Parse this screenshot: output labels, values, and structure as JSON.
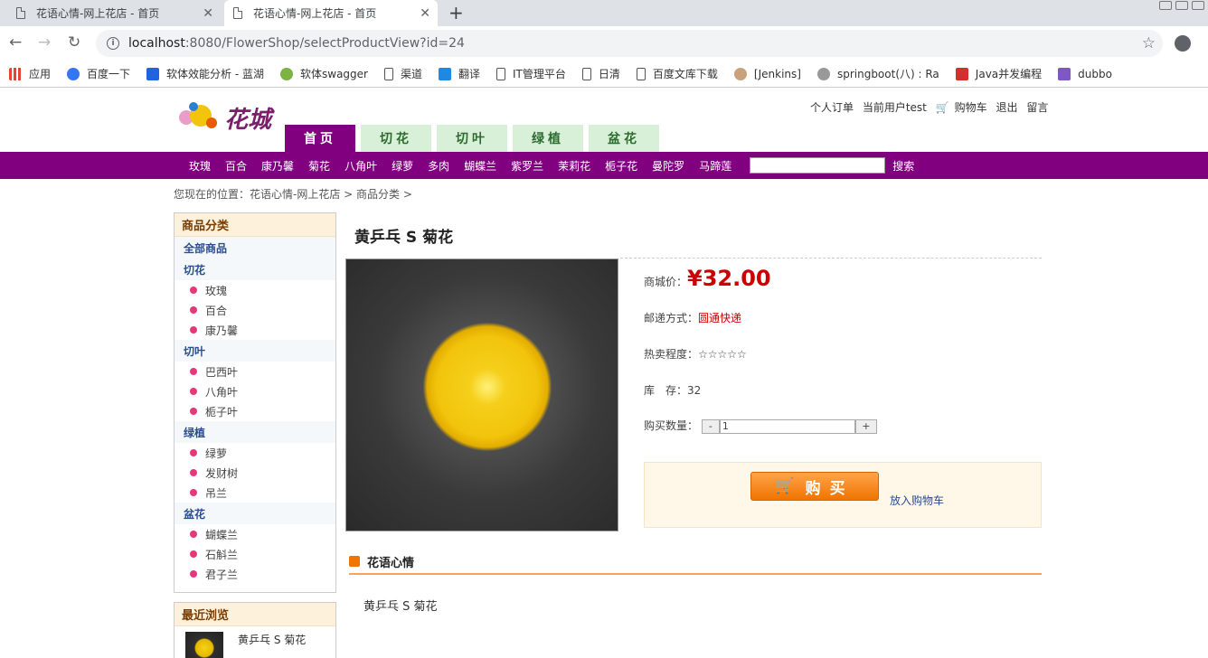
{
  "browser": {
    "tabs": [
      {
        "title": "花语心情-网上花店 - 首页"
      },
      {
        "title": "花语心情-网上花店 - 首页"
      }
    ],
    "url_host": "localhost",
    "url_rest": ":8080/FlowerShop/selectProductView?id=24",
    "bookmarks": [
      "应用",
      "百度一下",
      "软体效能分析 - 蓝湖",
      "软体swagger",
      "渠道",
      "翻译",
      "IT管理平台",
      "日清",
      "百度文库下载",
      "[Jenkins]",
      "springboot(八) : Ra",
      "Java并发编程",
      "dubbo"
    ]
  },
  "site": {
    "logo_text": "花城",
    "toplinks": [
      "个人订单",
      "当前用户test",
      "购物车",
      "退出",
      "留言"
    ],
    "main_tabs": [
      "首页",
      "切花",
      "切叶",
      "绿植",
      "盆花"
    ],
    "categories": [
      "玫瑰",
      "百合",
      "康乃馨",
      "菊花",
      "八角叶",
      "绿萝",
      "多肉",
      "蝴蝶兰",
      "紫罗兰",
      "茉莉花",
      "栀子花",
      "曼陀罗",
      "马蹄莲"
    ],
    "search_label": "搜索",
    "breadcrumb": "您现在的位置：花语心情-网上花店 > 商品分类 >"
  },
  "sidebar": {
    "title": "商品分类",
    "all": "全部商品",
    "groups": [
      {
        "name": "切花",
        "items": [
          "玫瑰",
          "百合",
          "康乃馨"
        ]
      },
      {
        "name": "切叶",
        "items": [
          "巴西叶",
          "八角叶",
          "栀子叶"
        ]
      },
      {
        "name": "绿植",
        "items": [
          "绿萝",
          "发财树",
          "吊兰"
        ]
      },
      {
        "name": "盆花",
        "items": [
          "蝴蝶兰",
          "石斛兰",
          "君子兰"
        ]
      }
    ],
    "recent_title": "最近浏览",
    "recent_item": "黄乒乓 S 菊花"
  },
  "product": {
    "title": "黄乒乓 S 菊花",
    "price_label": "商城价：",
    "price": "¥32.00",
    "ship_label": "邮递方式：",
    "ship_value": "圆通快递",
    "hot_label": "热卖程度：",
    "hot_value": "☆☆☆☆☆",
    "stock_label": "库　存：",
    "stock_value": "32",
    "qty_label": "购买数量：",
    "qty_minus": "-",
    "qty_value": "1",
    "qty_plus": "+",
    "buy_label": "购买",
    "addcart": "放入购物车",
    "section_title": "花语心情",
    "description": "黄乒乓 S 菊花"
  }
}
